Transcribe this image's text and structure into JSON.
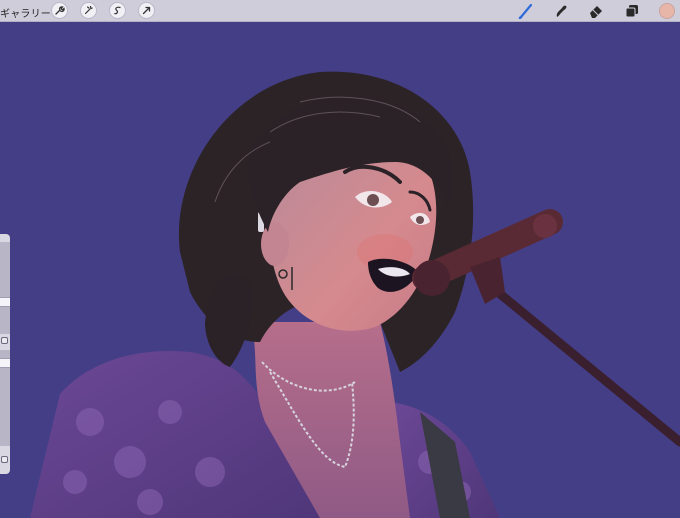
{
  "topbar": {
    "gallery_label": "ギャラリー",
    "left_tools": [
      "wrench-icon",
      "magic-wand-icon",
      "selection-icon",
      "transform-arrow-icon"
    ],
    "right_tools": [
      "brush-icon",
      "smudge-icon",
      "eraser-icon",
      "layers-icon"
    ],
    "active_tool": "brush-icon",
    "color_swatch": "#e7b6a9",
    "accent": "#2f6bd9"
  },
  "canvas": {
    "background": "#443e86",
    "artwork": "illustration"
  },
  "sidebar": {
    "sliders": [
      "brush-size-slider",
      "opacity-slider"
    ],
    "buttons": [
      "modify-button",
      "undo-button"
    ]
  }
}
